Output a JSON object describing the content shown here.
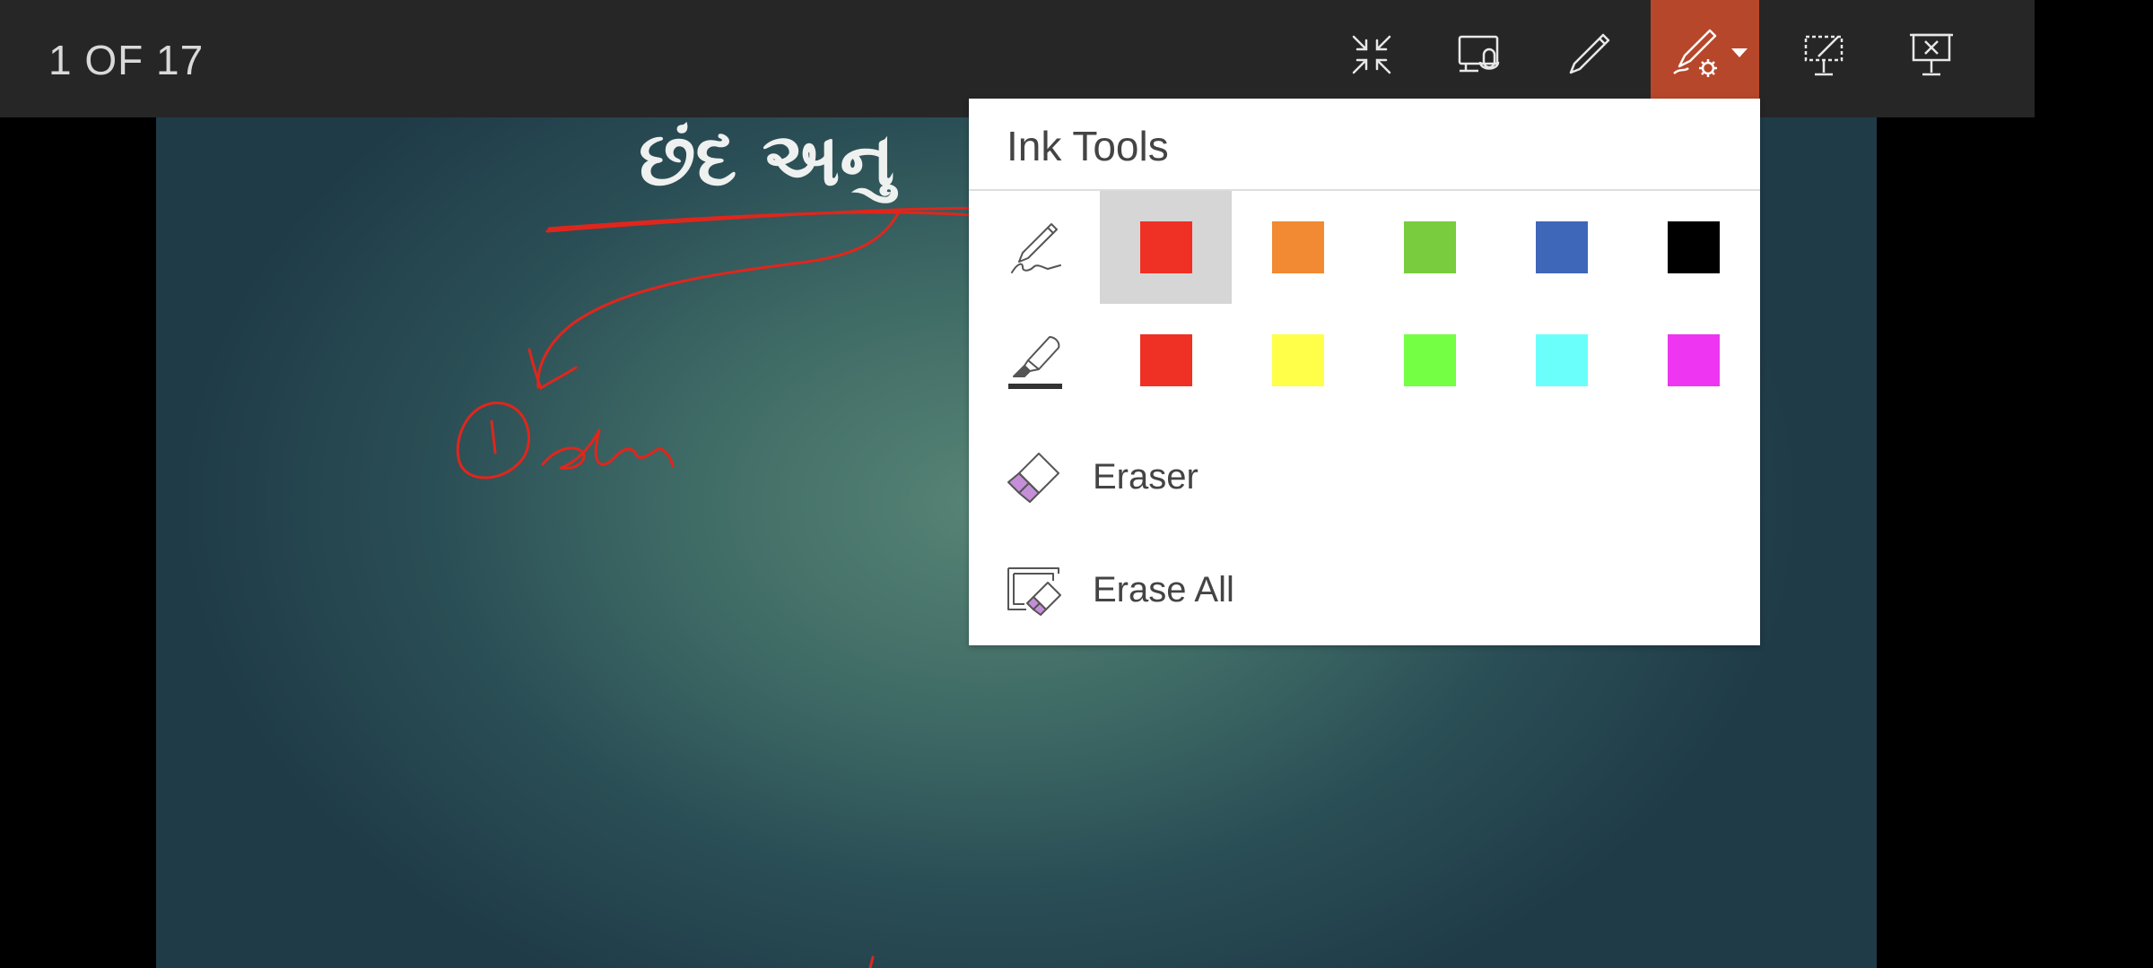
{
  "toolbar": {
    "slide_counter": "1 OF 17",
    "accent_color": "#b7472a",
    "icons": [
      "exit-fullscreen-icon",
      "laser-pointer-icon",
      "pen-icon",
      "pen-settings-icon",
      "hide-slide-icon",
      "end-show-icon"
    ]
  },
  "slide": {
    "title": "છંદ અનુ"
  },
  "ink_menu": {
    "title": "Ink Tools",
    "pen_colors": [
      {
        "name": "red",
        "hex": "#ee3124",
        "selected": true
      },
      {
        "name": "orange",
        "hex": "#f18a33",
        "selected": false
      },
      {
        "name": "green",
        "hex": "#78cc3e",
        "selected": false
      },
      {
        "name": "blue",
        "hex": "#3e66b9",
        "selected": false
      },
      {
        "name": "black",
        "hex": "#000000",
        "selected": false
      }
    ],
    "highlighter_colors": [
      {
        "name": "red",
        "hex": "#ee3124"
      },
      {
        "name": "yellow",
        "hex": "#ffff4a"
      },
      {
        "name": "green",
        "hex": "#74ff44"
      },
      {
        "name": "cyan",
        "hex": "#6bfffc"
      },
      {
        "name": "magenta",
        "hex": "#ee36f2"
      }
    ],
    "eraser_label": "Eraser",
    "erase_all_label": "Erase All"
  }
}
